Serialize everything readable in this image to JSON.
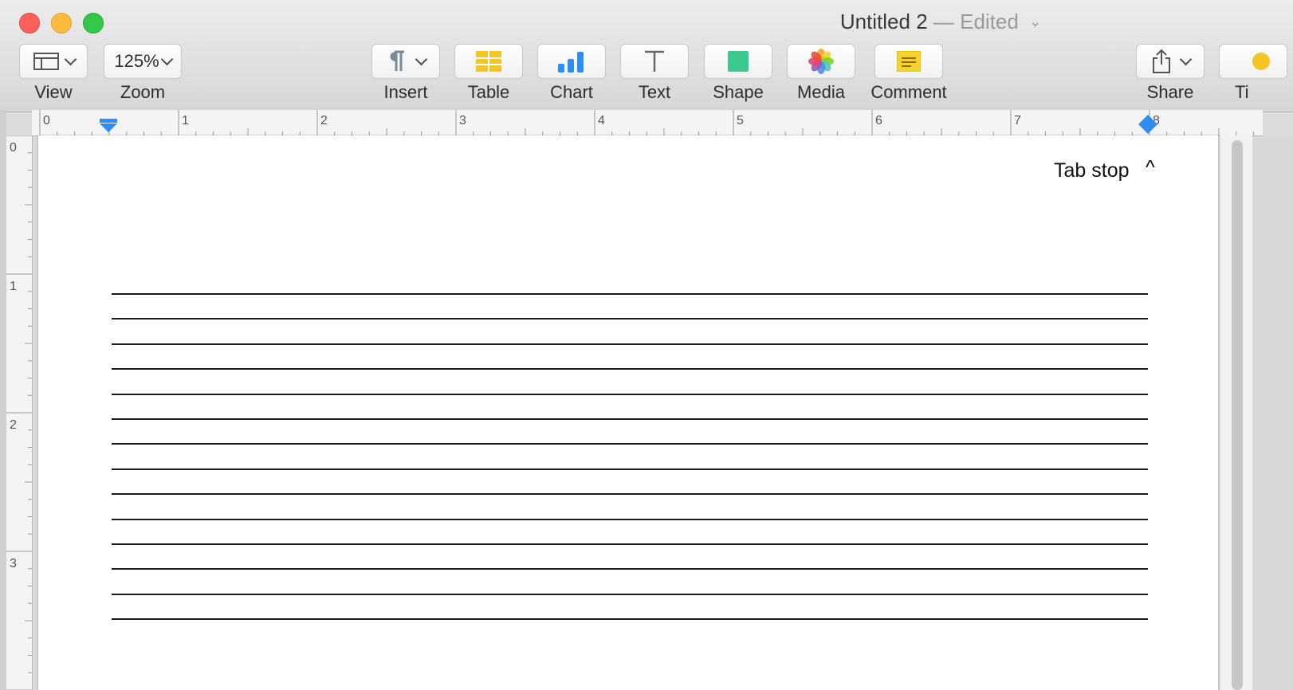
{
  "window": {
    "title": "Untitled 2",
    "edited": "— Edited"
  },
  "toolbar": {
    "view_label": "View",
    "zoom_value": "125%",
    "zoom_label": "Zoom",
    "insert_label": "Insert",
    "table_label": "Table",
    "chart_label": "Chart",
    "text_label": "Text",
    "shape_label": "Shape",
    "media_label": "Media",
    "comment_label": "Comment",
    "share_label": "Share",
    "tips_label": "Ti"
  },
  "ruler": {
    "h_numbers": [
      "0",
      "1",
      "2",
      "3",
      "4",
      "5",
      "6",
      "7",
      "8"
    ],
    "v_numbers": [
      "0",
      "1",
      "2",
      "3"
    ]
  },
  "document": {
    "tab_stop_text": "Tab stop",
    "caret_text": "^",
    "underline_count": 14
  },
  "colors": {
    "table_icon": "#f5c523",
    "chart_icon": "#2b8ef0",
    "shape_icon": "#3cc98f",
    "comment_icon": "#f7d22a",
    "ruler_marker": "#2f8cf0"
  }
}
